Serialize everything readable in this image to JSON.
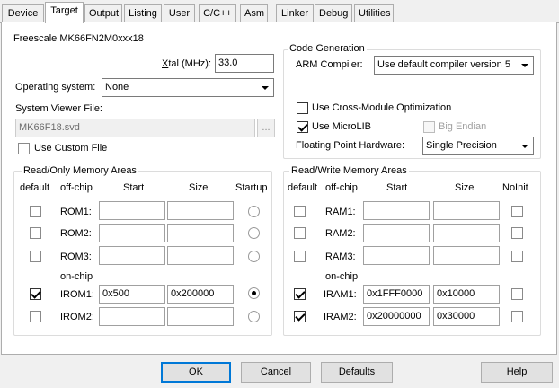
{
  "tabs": [
    {
      "label": "Device",
      "active": false
    },
    {
      "label": "Target",
      "active": true
    },
    {
      "label": "Output",
      "active": false
    },
    {
      "label": "Listing",
      "active": false
    },
    {
      "label": "User",
      "active": false
    },
    {
      "label": "C/C++",
      "active": false
    },
    {
      "label": "Asm",
      "active": false
    },
    {
      "label": "Linker",
      "active": false
    },
    {
      "label": "Debug",
      "active": false
    },
    {
      "label": "Utilities",
      "active": false
    }
  ],
  "device_name": "Freescale MK66FN2M0xxx18",
  "xtal": {
    "label_prefix": "X",
    "label_rest": "tal (MHz):",
    "value": "33.0"
  },
  "os": {
    "label": "Operating system:",
    "value": "None"
  },
  "svf": {
    "label": "System Viewer File:",
    "value": "MK66F18.svd",
    "browse": "..."
  },
  "custom_file": {
    "label": "Use Custom File",
    "checked": false
  },
  "code_gen": {
    "title": "Code Generation",
    "compiler_label": "ARM Compiler:",
    "compiler_value": "Use default compiler version 5",
    "cross_module": {
      "label": "Use Cross-Module Optimization",
      "checked": false
    },
    "microlib": {
      "label": "Use MicroLIB",
      "checked": true
    },
    "big_endian": {
      "label": "Big Endian",
      "checked": false
    },
    "fph_label": "Floating Point Hardware:",
    "fph_value": "Single Precision"
  },
  "ro": {
    "title": "Read/Only Memory Areas",
    "headers": {
      "default": "default",
      "offchip": "off-chip",
      "start": "Start",
      "size": "Size",
      "startup": "Startup"
    },
    "onchip_label": "on-chip",
    "rows": [
      {
        "name": "ROM1:",
        "default": false,
        "start": "",
        "size": "",
        "startup": false
      },
      {
        "name": "ROM2:",
        "default": false,
        "start": "",
        "size": "",
        "startup": false
      },
      {
        "name": "ROM3:",
        "default": false,
        "start": "",
        "size": "",
        "startup": false
      },
      {
        "name": "IROM1:",
        "default": true,
        "start": "0x500",
        "size": "0x200000",
        "startup": true
      },
      {
        "name": "IROM2:",
        "default": false,
        "start": "",
        "size": "",
        "startup": false
      }
    ]
  },
  "rw": {
    "title": "Read/Write Memory Areas",
    "headers": {
      "default": "default",
      "offchip": "off-chip",
      "start": "Start",
      "size": "Size",
      "noinit": "NoInit"
    },
    "onchip_label": "on-chip",
    "rows": [
      {
        "name": "RAM1:",
        "default": false,
        "start": "",
        "size": "",
        "noinit": false
      },
      {
        "name": "RAM2:",
        "default": false,
        "start": "",
        "size": "",
        "noinit": false
      },
      {
        "name": "RAM3:",
        "default": false,
        "start": "",
        "size": "",
        "noinit": false
      },
      {
        "name": "IRAM1:",
        "default": true,
        "start": "0x1FFF0000",
        "size": "0x10000",
        "noinit": false
      },
      {
        "name": "IRAM2:",
        "default": true,
        "start": "0x20000000",
        "size": "0x30000",
        "noinit": false
      }
    ]
  },
  "buttons": {
    "ok": "OK",
    "cancel": "Cancel",
    "defaults": "Defaults",
    "help": "Help"
  }
}
